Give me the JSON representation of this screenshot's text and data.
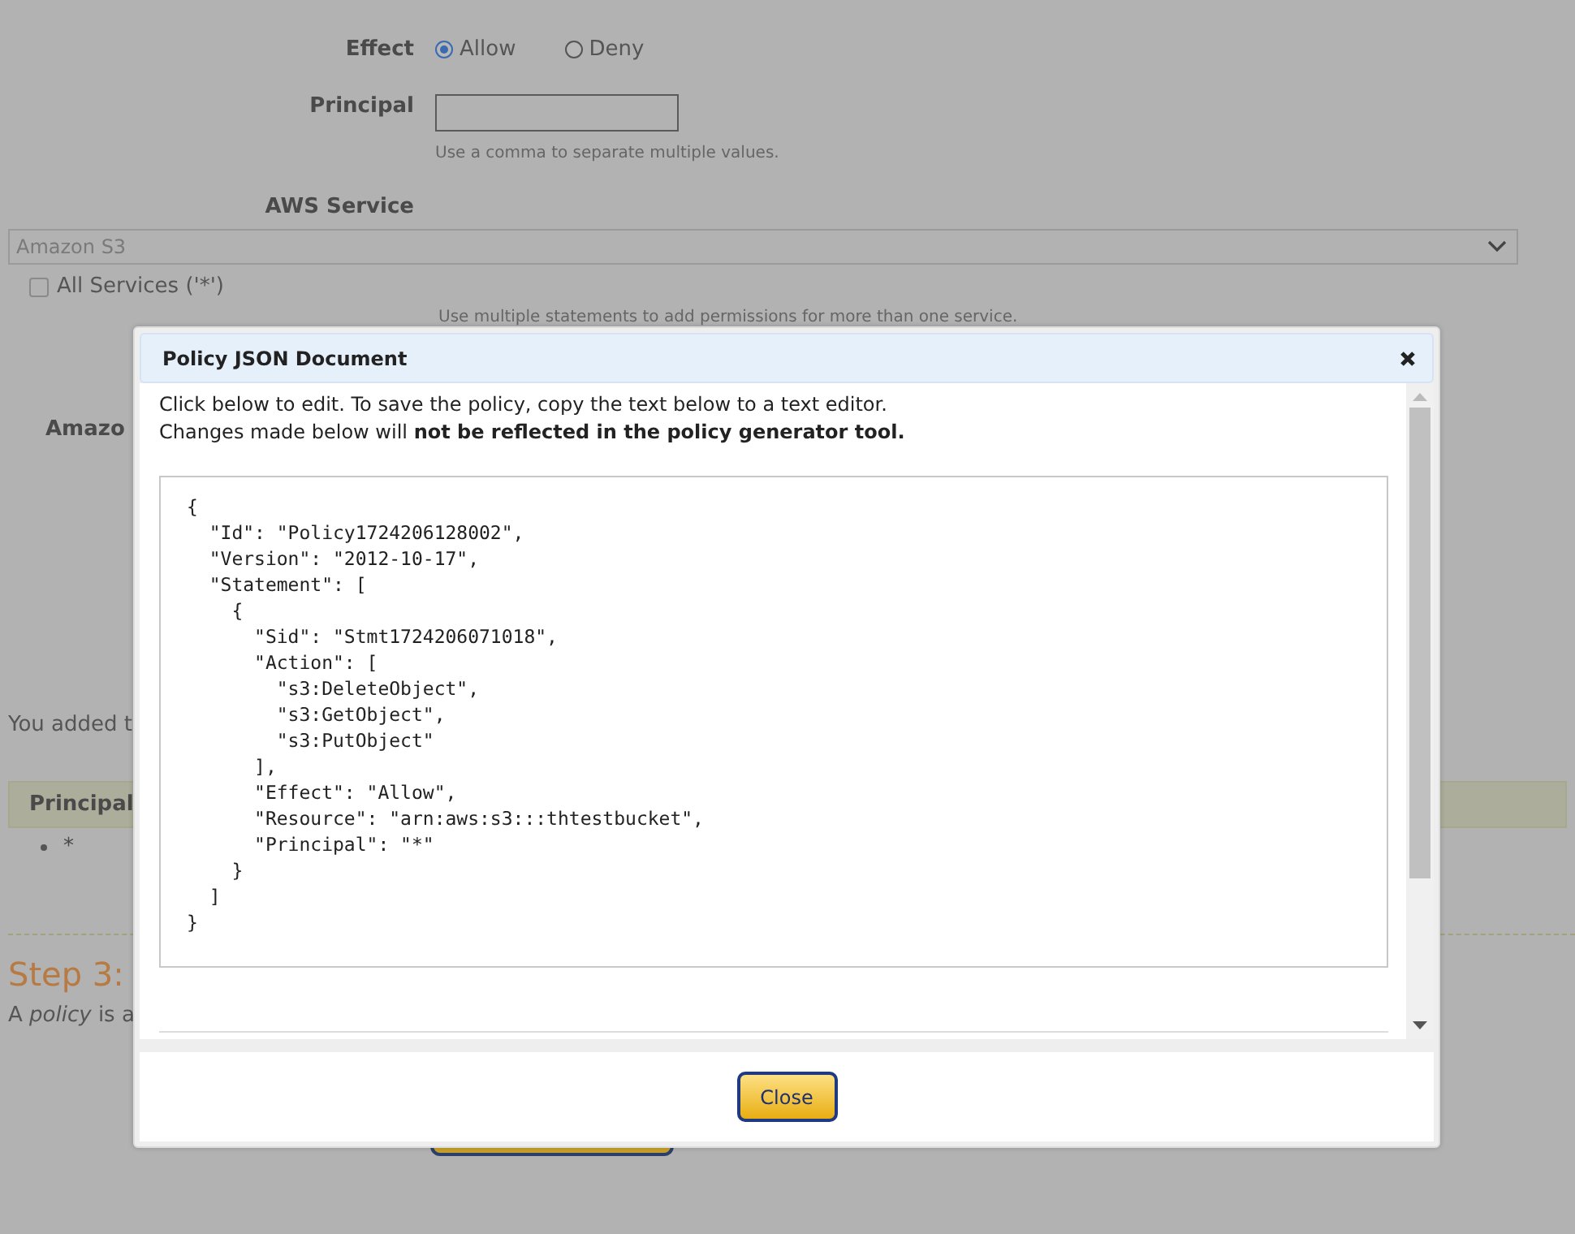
{
  "form": {
    "effect": {
      "label": "Effect",
      "options": [
        {
          "label": "Allow",
          "selected": true
        },
        {
          "label": "Deny",
          "selected": false
        }
      ]
    },
    "principal": {
      "label": "Principal",
      "hint": "Use a comma to separate multiple values."
    },
    "service": {
      "label": "AWS Service",
      "value": "Amazon S3",
      "all_services": {
        "label": "All Services ('*')",
        "checked": false
      },
      "hint": "Use multiple statements to add permissions for more than one service."
    },
    "cut_label": "Amazo"
  },
  "added_text": "You added t",
  "statements_table": {
    "header": "Principal",
    "items": [
      "*"
    ]
  },
  "step": {
    "title": "Step 3:",
    "text": "A *policy* is a"
  },
  "modal": {
    "title": "Policy JSON Document",
    "intro": "Click below to edit. To save the policy, copy the text below to a text editor.",
    "note": "Changes made below will **not be reflected in the policy generator tool.**",
    "code": "{\n  \"Id\": \"Policy1724206128002\",\n  \"Version\": \"2012-10-17\",\n  \"Statement\": [\n    {\n      \"Sid\": \"Stmt1724206071018\",\n      \"Action\": [\n        \"s3:DeleteObject\",\n        \"s3:GetObject\",\n        \"s3:PutObject\"\n      ],\n      \"Effect\": \"Allow\",\n      \"Resource\": \"arn:aws:s3:::thtestbucket\",\n      \"Principal\": \"*\"\n    }\n  ]\n}",
    "close_button": "Close"
  }
}
